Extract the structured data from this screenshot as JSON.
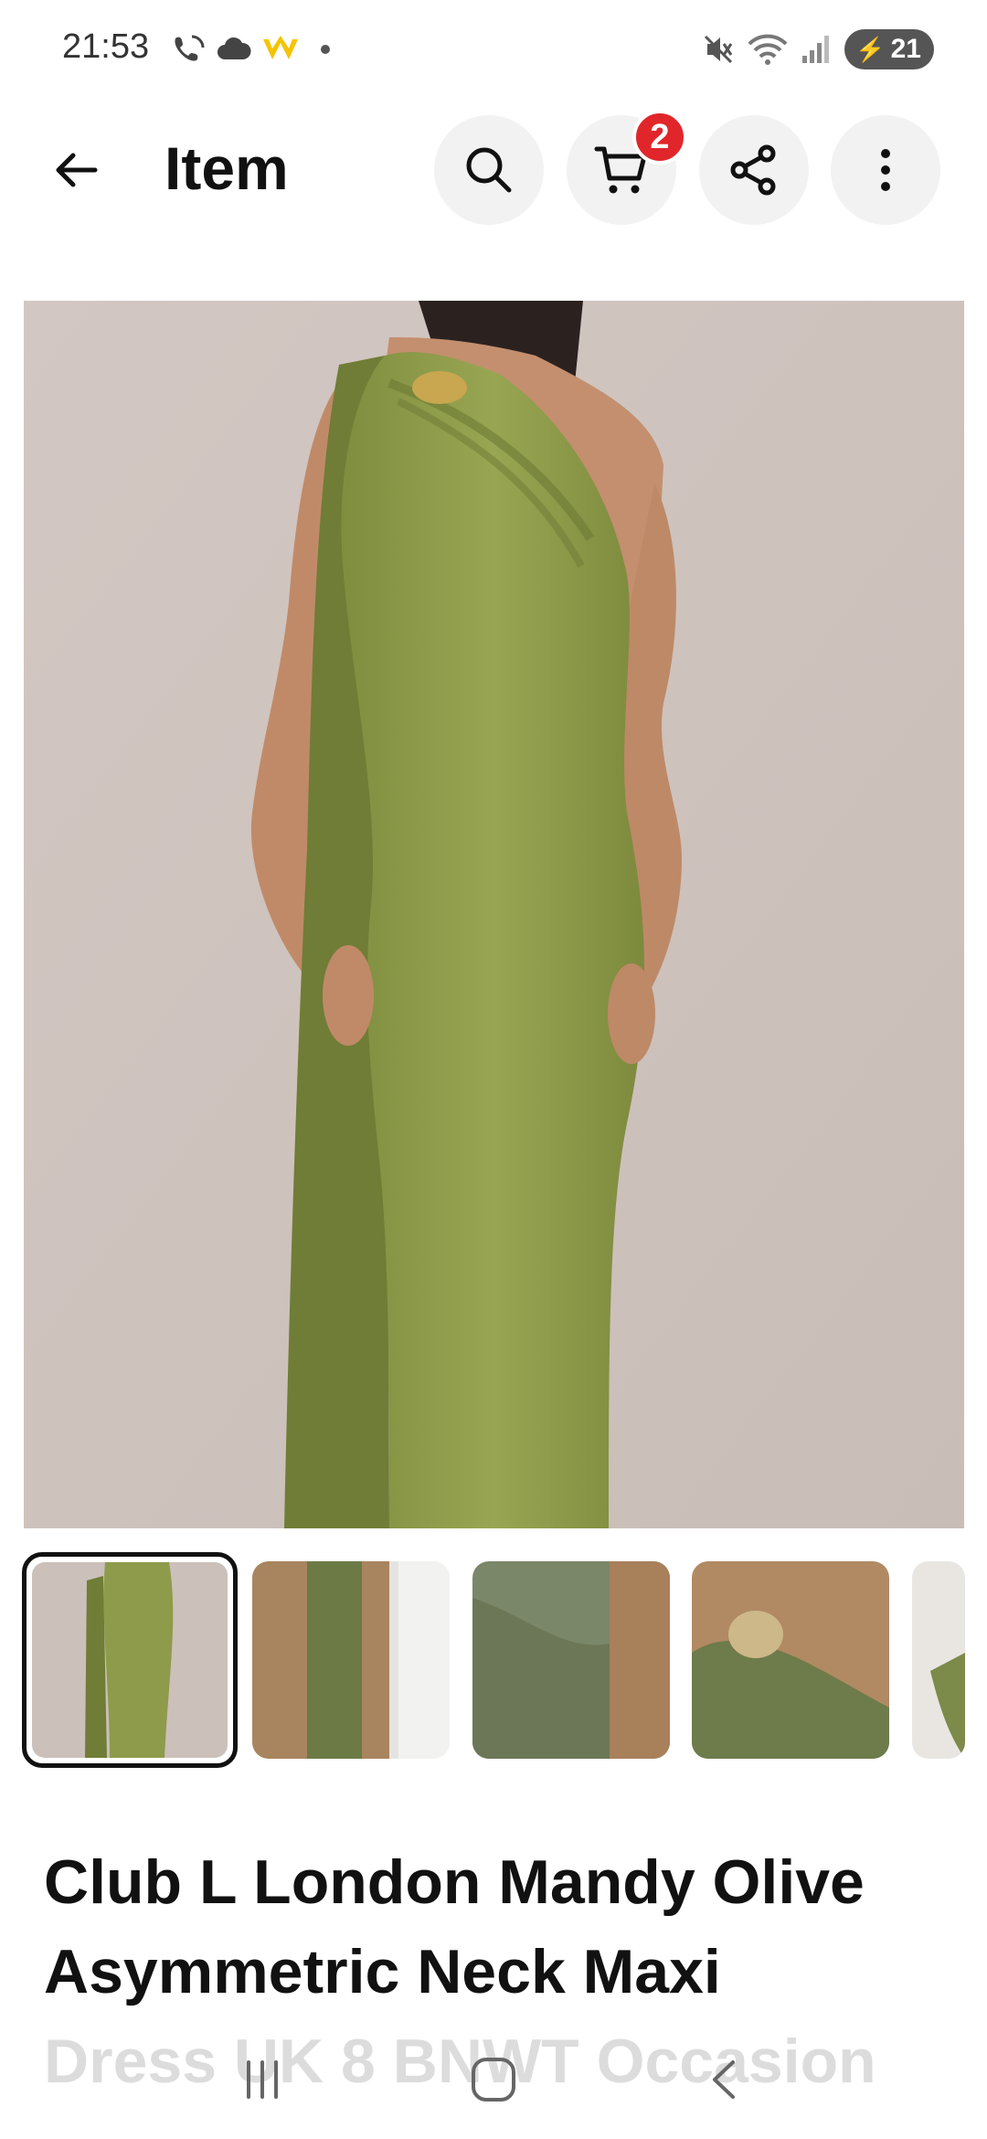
{
  "status_bar": {
    "time": "21:53",
    "battery": "21",
    "icons_left": [
      "wifi-call-icon",
      "cloud-icon",
      "crown-icon",
      "dot-icon"
    ],
    "icons_right": [
      "mute-icon",
      "wifi-icon",
      "signal-icon",
      "battery-icon"
    ]
  },
  "app_bar": {
    "title": "Item",
    "cart_count": "2"
  },
  "gallery": {
    "thumbnails": [
      "thumbnail-1",
      "thumbnail-2",
      "thumbnail-3",
      "thumbnail-4",
      "thumbnail-5"
    ],
    "selected_index": 0
  },
  "item": {
    "title_line1": "Club L London Mandy Olive",
    "title_line2": "Asymmetric Neck Maxi",
    "title_line3": "Dress UK 8 BNWT Occasion"
  },
  "colors": {
    "badge": "#e0262b",
    "dress": "#8c9a4a",
    "backdrop": "#cfc4bf"
  }
}
